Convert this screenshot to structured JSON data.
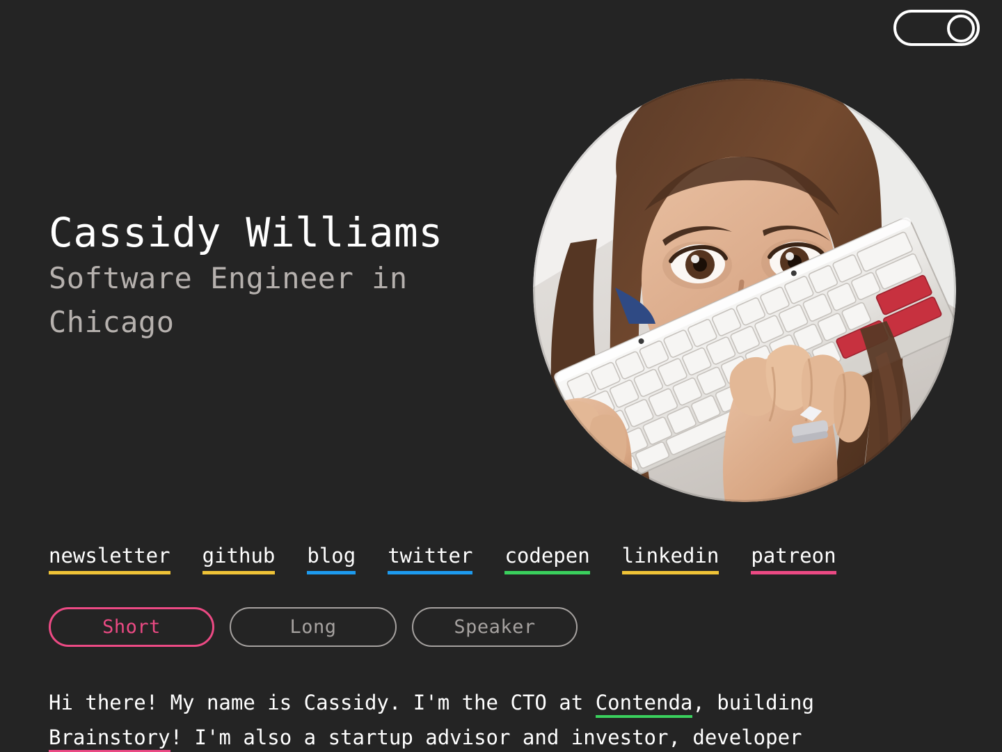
{
  "theme": {
    "background": "#242424",
    "text": "#ffffff",
    "muted": "#b6b1ae",
    "pink": "#ec4a84",
    "green": "#3ad05d",
    "blue": "#1d9bef",
    "yellow": "#efc337",
    "gray_border": "#a6a2a0"
  },
  "toggle": {
    "name": "dark-mode-toggle",
    "state": "on",
    "knob_position": "right"
  },
  "header": {
    "name": "Cassidy Williams",
    "tagline": "Software Engineer in Chicago"
  },
  "avatar": {
    "alt": "Cassidy Williams holding a white mechanical keyboard in front of her face",
    "shape": "circle"
  },
  "links": [
    {
      "label": "newsletter",
      "underline_color": "#efc337"
    },
    {
      "label": "github",
      "underline_color": "#efc337"
    },
    {
      "label": "blog",
      "underline_color": "#1d9bef"
    },
    {
      "label": "twitter",
      "underline_color": "#1d9bef"
    },
    {
      "label": "codepen",
      "underline_color": "#3ad05d"
    },
    {
      "label": "linkedin",
      "underline_color": "#efc337"
    },
    {
      "label": "patreon",
      "underline_color": "#ec4a84"
    }
  ],
  "tabs": [
    {
      "label": "Short",
      "active": true
    },
    {
      "label": "Long",
      "active": false
    },
    {
      "label": "Speaker",
      "active": false
    }
  ],
  "bio": {
    "part1": "Hi there! My name is Cassidy. I'm the CTO at ",
    "link1": "Contenda",
    "part2": ", building ",
    "link2": "Brainstory",
    "part3": "! I'm also a startup advisor and investor, developer"
  }
}
